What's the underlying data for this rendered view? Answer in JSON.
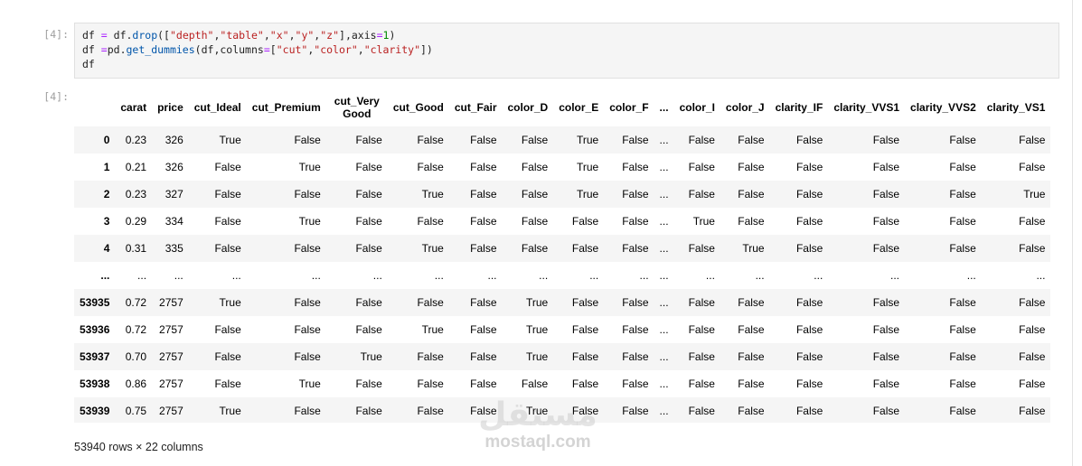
{
  "cells": {
    "input_prompt": "[4]:",
    "output_prompt": "[4]:",
    "code_lines": [
      "df = df.drop([\"depth\",\"table\",\"x\",\"y\",\"z\"],axis=1)",
      "df =pd.get_dummies(df,columns=[\"cut\",\"color\",\"clarity\"])",
      "df"
    ]
  },
  "table": {
    "columns": [
      "",
      "carat",
      "price",
      "cut_Ideal",
      "cut_Premium",
      "cut_Very Good",
      "cut_Good",
      "cut_Fair",
      "color_D",
      "color_E",
      "color_F",
      "...",
      "color_I",
      "color_J",
      "clarity_IF",
      "clarity_VVS1",
      "clarity_VVS2",
      "clarity_VS1"
    ],
    "rows": [
      [
        "0",
        "0.23",
        "326",
        "True",
        "False",
        "False",
        "False",
        "False",
        "False",
        "True",
        "False",
        "...",
        "False",
        "False",
        "False",
        "False",
        "False",
        "False"
      ],
      [
        "1",
        "0.21",
        "326",
        "False",
        "True",
        "False",
        "False",
        "False",
        "False",
        "True",
        "False",
        "...",
        "False",
        "False",
        "False",
        "False",
        "False",
        "False"
      ],
      [
        "2",
        "0.23",
        "327",
        "False",
        "False",
        "False",
        "True",
        "False",
        "False",
        "True",
        "False",
        "...",
        "False",
        "False",
        "False",
        "False",
        "False",
        "True"
      ],
      [
        "3",
        "0.29",
        "334",
        "False",
        "True",
        "False",
        "False",
        "False",
        "False",
        "False",
        "False",
        "...",
        "True",
        "False",
        "False",
        "False",
        "False",
        "False"
      ],
      [
        "4",
        "0.31",
        "335",
        "False",
        "False",
        "False",
        "True",
        "False",
        "False",
        "False",
        "False",
        "...",
        "False",
        "True",
        "False",
        "False",
        "False",
        "False"
      ],
      [
        "...",
        "...",
        "...",
        "...",
        "...",
        "...",
        "...",
        "...",
        "...",
        "...",
        "...",
        "...",
        "...",
        "...",
        "...",
        "...",
        "...",
        "..."
      ],
      [
        "53935",
        "0.72",
        "2757",
        "True",
        "False",
        "False",
        "False",
        "False",
        "True",
        "False",
        "False",
        "...",
        "False",
        "False",
        "False",
        "False",
        "False",
        "False"
      ],
      [
        "53936",
        "0.72",
        "2757",
        "False",
        "False",
        "False",
        "True",
        "False",
        "True",
        "False",
        "False",
        "...",
        "False",
        "False",
        "False",
        "False",
        "False",
        "False"
      ],
      [
        "53937",
        "0.70",
        "2757",
        "False",
        "False",
        "True",
        "False",
        "False",
        "True",
        "False",
        "False",
        "...",
        "False",
        "False",
        "False",
        "False",
        "False",
        "False"
      ],
      [
        "53938",
        "0.86",
        "2757",
        "False",
        "True",
        "False",
        "False",
        "False",
        "False",
        "False",
        "False",
        "...",
        "False",
        "False",
        "False",
        "False",
        "False",
        "False"
      ],
      [
        "53939",
        "0.75",
        "2757",
        "True",
        "False",
        "False",
        "False",
        "False",
        "True",
        "False",
        "False",
        "...",
        "False",
        "False",
        "False",
        "False",
        "False",
        "False"
      ]
    ]
  },
  "summary": "53940 rows × 22 columns",
  "watermark": {
    "arabic": "مستقل",
    "latin": "mostaql.com"
  },
  "colors": {
    "prompt": "#9e9e9e",
    "code_bg": "#f5f5f5",
    "string": "#ba2121",
    "operator": "#aa22ff",
    "number": "#008800",
    "function": "#0055aa"
  }
}
